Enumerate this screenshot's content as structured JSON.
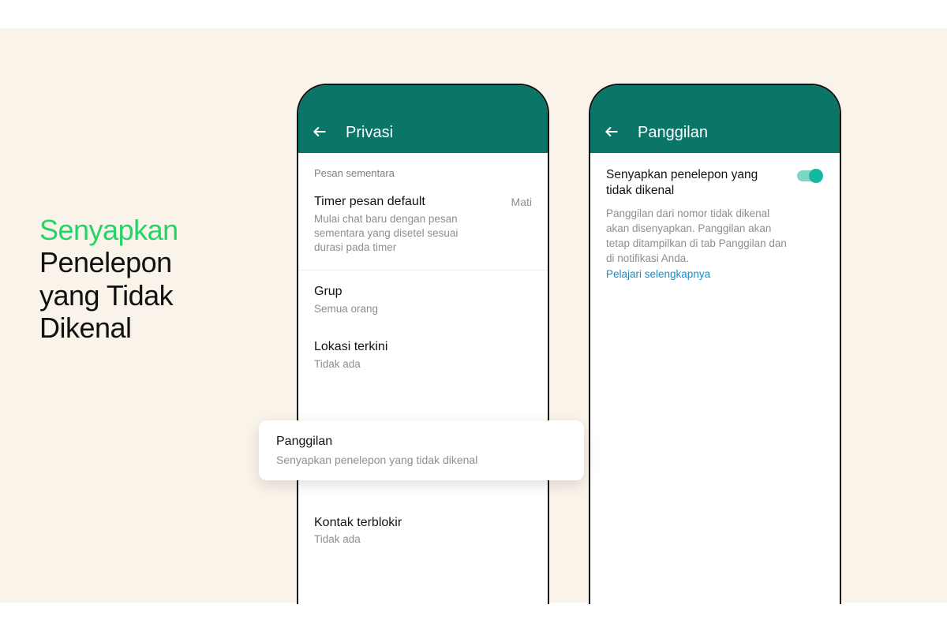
{
  "colors": {
    "appbar": "#0b7568",
    "accent": "#25d366",
    "toggle_knob": "#14b8a0",
    "toggle_track": "#7ed7c1",
    "link": "#1e88c3",
    "bg": "#faf3ea"
  },
  "headline": {
    "line1": "Senyapkan",
    "line2": "Penelepon",
    "line3": "yang Tidak",
    "line4": "Dikenal"
  },
  "phoneLeft": {
    "appbar_title": "Privasi",
    "section_header": "Pesan sementara",
    "timer": {
      "title": "Timer pesan default",
      "value": "Mati",
      "sub": "Mulai chat baru dengan pesan sementara yang disetel sesuai durasi pada timer"
    },
    "group": {
      "title": "Grup",
      "sub": "Semua orang"
    },
    "location": {
      "title": "Lokasi terkini",
      "sub": "Tidak ada"
    },
    "calls_popout": {
      "title": "Panggilan",
      "sub": "Senyapkan penelepon yang tidak dikenal"
    },
    "blocked": {
      "title": "Kontak terblokir",
      "sub": "Tidak ada"
    }
  },
  "phoneRight": {
    "appbar_title": "Panggilan",
    "toggle": {
      "title": "Senyapkan penelepon yang tidak dikenal",
      "desc": "Panggilan dari nomor tidak dikenal akan disenyapkan. Panggilan akan tetap ditampilkan di tab Panggilan dan di notifikasi Anda.",
      "link": "Pelajari selengkapnya",
      "state": "on"
    }
  }
}
